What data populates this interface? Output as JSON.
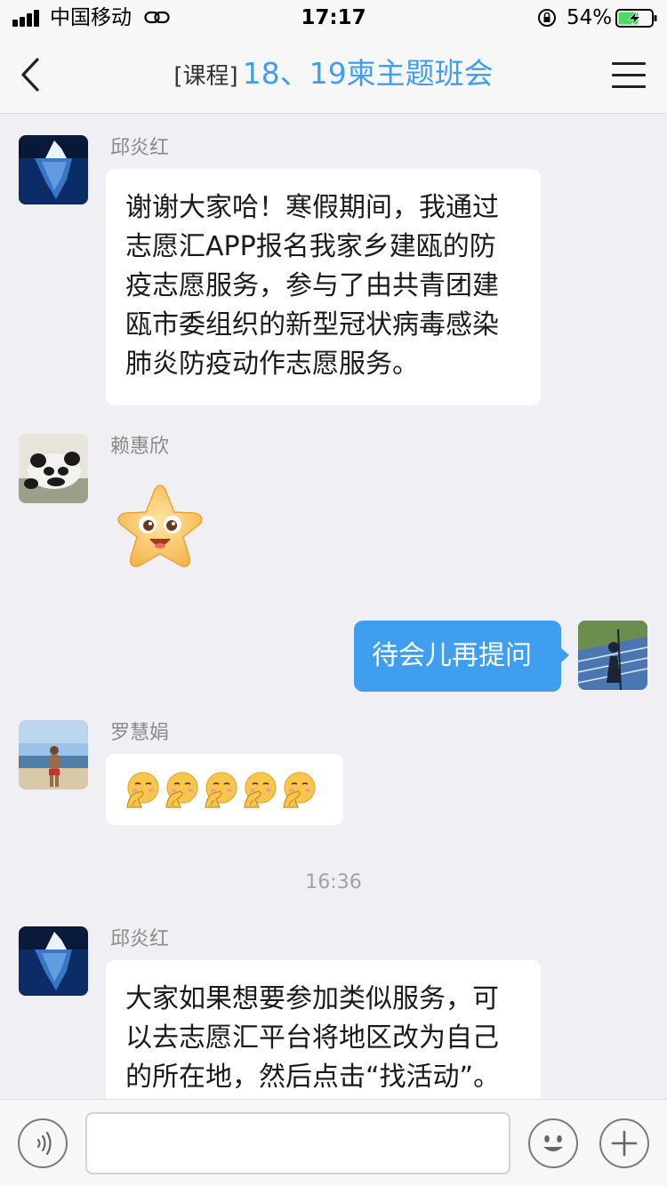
{
  "status_bar": {
    "carrier": "中国移动",
    "time": "17:17",
    "battery_percent": "54%"
  },
  "nav": {
    "back_icon": "chevron-left-icon",
    "title_tag": "[课程]",
    "title_name": "18、19柬主题班会",
    "menu_icon": "hamburger-menu-icon"
  },
  "messages": [
    {
      "sender": "邱炎红",
      "avatar": "iceberg-avatar",
      "lines": [
        "谢谢大家哈！寒假期间，我通过",
        "志愿汇APP报名我家乡建瓯的防",
        "疫志愿服务，参与了由共青团建",
        "瓯市委组织的新型冠状病毒感染",
        "肺炎防疫动作志愿服务。"
      ]
    },
    {
      "sender": "赖惠欣",
      "avatar": "panda-avatar",
      "sticker": "smiling-star-sticker"
    },
    {
      "mine": true,
      "text": "待会儿再提问",
      "avatar": "track-shadow-avatar"
    },
    {
      "sender": "罗慧娟",
      "avatar": "beach-avatar",
      "emojis": [
        "shush-emoji",
        "shush-emoji",
        "shush-emoji",
        "shush-emoji",
        "shush-emoji"
      ]
    },
    {
      "timestamp": "16:36"
    },
    {
      "sender": "邱炎红",
      "avatar": "iceberg-avatar",
      "lines": [
        "大家如果想要参加类似服务，可",
        "以去志愿汇平台将地区改为自己",
        "的所在地，然后点击“找活动”。"
      ]
    }
  ],
  "input_bar": {
    "voice_icon": "voice-icon",
    "text_value": "",
    "emoji_icon": "smiley-icon",
    "plus_icon": "plus-icon"
  },
  "colors": {
    "accent": "#3f9ef0",
    "background": "#efeff4",
    "bubble": "#ffffff",
    "battery_fill": "#4cd964"
  }
}
